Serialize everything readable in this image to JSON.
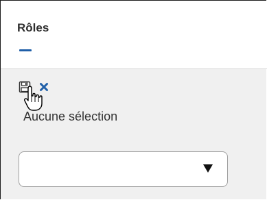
{
  "panel": {
    "title": "Rôles",
    "accent_color": "#1f5fa8"
  },
  "toolbar": {
    "save_icon": "save-icon",
    "delete_icon": "close-icon"
  },
  "selection": {
    "status_text": "Aucune sélection"
  },
  "role_select": {
    "value": ""
  }
}
